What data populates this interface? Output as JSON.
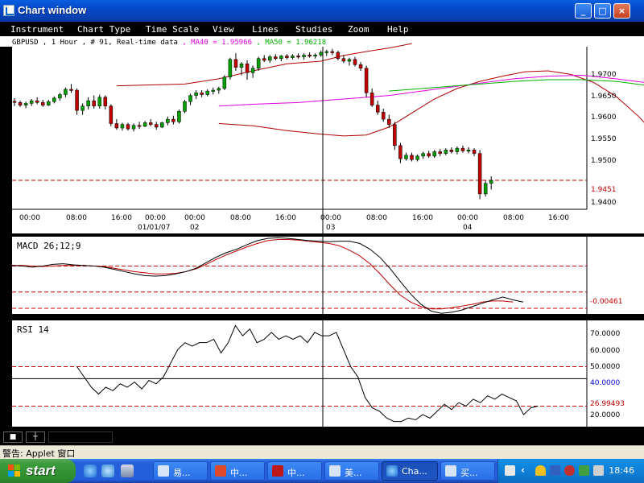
{
  "window": {
    "title": "Chart window",
    "buttons": {
      "minimize": "_",
      "maximize": "□",
      "close": "×"
    }
  },
  "menu": {
    "items": [
      "Instrument",
      "Chart Type",
      "Time Scale",
      "View",
      "Lines",
      "Studies",
      "Zoom",
      "Help"
    ]
  },
  "colors": {
    "background": "#000000",
    "panel": "#ffffff",
    "candle_up": "#00a000",
    "candle_down": "#c00000",
    "bollinger": "#b00000",
    "ma40": "#e000e0",
    "ma50": "#00b000",
    "macd": "#000000",
    "macd_signal": "#c00000",
    "rsi": "#000000",
    "dashed_level": "#c00000",
    "indicator_value": "#c00000"
  },
  "chart_header": {
    "symbol_info": "GBPUSD , 1 Hour , # 91, Real-time data",
    "ma40": ", MA40 = 1.95966",
    "ma50": ", MA50 = 1.96218"
  },
  "price_axis": {
    "ticks": [
      "1.9700",
      "1.9650",
      "1.9600",
      "1.9550",
      "1.9500",
      "1.9400"
    ],
    "current_price_label": "1.9451"
  },
  "time_axis": {
    "time_labels": [
      "00:00",
      "08:00",
      "16:00",
      "00:00",
      "00:00",
      "08:00",
      "16:00",
      "00:00",
      "08:00",
      "16:00",
      "00:00",
      "08:00",
      "16:00"
    ],
    "date_labels": [
      "01/01/07",
      "02",
      "03",
      "04"
    ]
  },
  "macd_panel": {
    "label": "MACD 26;12;9",
    "value_label": "-0.00461"
  },
  "rsi_panel": {
    "label": "RSI 14",
    "ticks": [
      "70.0000",
      "60.0000",
      "50.0000",
      "40.0000",
      "26.99493",
      "20.0000"
    ]
  },
  "chart_data": {
    "type": "line",
    "price": {
      "ylim": [
        1.9385,
        1.9755
      ],
      "ticks": [
        1.97,
        1.965,
        1.96,
        1.955,
        1.95,
        1.94
      ],
      "current_price": 1.9451,
      "candles": [
        [
          1.9631,
          1.9638,
          1.962,
          1.9628
        ],
        [
          1.9628,
          1.9632,
          1.9618,
          1.9622
        ],
        [
          1.9622,
          1.963,
          1.9615,
          1.9626
        ],
        [
          1.9626,
          1.9636,
          1.962,
          1.9632
        ],
        [
          1.9632,
          1.964,
          1.9624,
          1.9628
        ],
        [
          1.9628,
          1.9634,
          1.9618,
          1.9622
        ],
        [
          1.9622,
          1.9634,
          1.962,
          1.963
        ],
        [
          1.963,
          1.9642,
          1.9626,
          1.9638
        ],
        [
          1.9638,
          1.965,
          1.9632,
          1.9646
        ],
        [
          1.9646,
          1.9662,
          1.964,
          1.9658
        ],
        [
          1.9658,
          1.967,
          1.965,
          1.9656
        ],
        [
          1.9656,
          1.966,
          1.96,
          1.961
        ],
        [
          1.961,
          1.9626,
          1.96,
          1.962
        ],
        [
          1.962,
          1.964,
          1.9612,
          1.9632
        ],
        [
          1.9632,
          1.9644,
          1.9614,
          1.962
        ],
        [
          1.962,
          1.9646,
          1.9614,
          1.964
        ],
        [
          1.964,
          1.9644,
          1.9612,
          1.962
        ],
        [
          1.962,
          1.9624,
          1.9574,
          1.958
        ],
        [
          1.958,
          1.959,
          1.9566,
          1.957
        ],
        [
          1.957,
          1.9582,
          1.9564,
          1.9578
        ],
        [
          1.9578,
          1.9582,
          1.9564,
          1.9568
        ],
        [
          1.9568,
          1.958,
          1.9562,
          1.9576
        ],
        [
          1.9576,
          1.9584,
          1.9568,
          1.9574
        ],
        [
          1.9574,
          1.9586,
          1.9572,
          1.9582
        ],
        [
          1.9582,
          1.959,
          1.9574,
          1.9578
        ],
        [
          1.9578,
          1.9584,
          1.9566,
          1.9572
        ],
        [
          1.9572,
          1.9584,
          1.957,
          1.9582
        ],
        [
          1.9582,
          1.9596,
          1.9576,
          1.959
        ],
        [
          1.959,
          1.9598,
          1.9578,
          1.9584
        ],
        [
          1.9584,
          1.9612,
          1.958,
          1.9608
        ],
        [
          1.9608,
          1.9634,
          1.9604,
          1.963
        ],
        [
          1.963,
          1.9648,
          1.9622,
          1.9644
        ],
        [
          1.9644,
          1.9656,
          1.9636,
          1.965
        ],
        [
          1.965,
          1.9656,
          1.964,
          1.9646
        ],
        [
          1.9646,
          1.9658,
          1.9642,
          1.9654
        ],
        [
          1.9654,
          1.9662,
          1.9646,
          1.9656
        ],
        [
          1.9656,
          1.9664,
          1.9648,
          1.966
        ],
        [
          1.966,
          1.969,
          1.9656,
          1.9686
        ],
        [
          1.9686,
          1.973,
          1.968,
          1.9726
        ],
        [
          1.9726,
          1.974,
          1.97,
          1.9708
        ],
        [
          1.9708,
          1.972,
          1.969,
          1.9716
        ],
        [
          1.9716,
          1.9724,
          1.968,
          1.9696
        ],
        [
          1.9696,
          1.9712,
          1.9684,
          1.9706
        ],
        [
          1.9706,
          1.9732,
          1.97,
          1.9728
        ],
        [
          1.9728,
          1.9736,
          1.972,
          1.9724
        ],
        [
          1.9724,
          1.9736,
          1.9718,
          1.9732
        ],
        [
          1.9732,
          1.9738,
          1.9724,
          1.9728
        ],
        [
          1.9728,
          1.9736,
          1.9722,
          1.9734
        ],
        [
          1.9734,
          1.9738,
          1.9726,
          1.973
        ],
        [
          1.973,
          1.9738,
          1.9726,
          1.9734
        ],
        [
          1.9734,
          1.974,
          1.9728,
          1.9732
        ],
        [
          1.9732,
          1.974,
          1.9726,
          1.9736
        ],
        [
          1.9736,
          1.9742,
          1.973,
          1.9734
        ],
        [
          1.9734,
          1.974,
          1.9728,
          1.9736
        ],
        [
          1.9736,
          1.9746,
          1.9732,
          1.9742
        ],
        [
          1.9742,
          1.9748,
          1.9734,
          1.9744
        ],
        [
          1.9744,
          1.975,
          1.9736,
          1.9742
        ],
        [
          1.9742,
          1.9746,
          1.9724,
          1.9728
        ],
        [
          1.9728,
          1.9736,
          1.9718,
          1.9722
        ],
        [
          1.9722,
          1.973,
          1.9712,
          1.9726
        ],
        [
          1.9726,
          1.9732,
          1.971,
          1.9714
        ],
        [
          1.9714,
          1.972,
          1.97,
          1.9706
        ],
        [
          1.9706,
          1.9712,
          1.964,
          1.965
        ],
        [
          1.965,
          1.966,
          1.9618,
          1.9622
        ],
        [
          1.9622,
          1.9632,
          1.96,
          1.9606
        ],
        [
          1.9606,
          1.9614,
          1.9584,
          1.959
        ],
        [
          1.959,
          1.96,
          1.957,
          1.9578
        ],
        [
          1.9578,
          1.9584,
          1.952,
          1.953
        ],
        [
          1.953,
          1.9536,
          1.949,
          1.95
        ],
        [
          1.95,
          1.9514,
          1.9496,
          1.9508
        ],
        [
          1.9508,
          1.9514,
          1.9494,
          1.9498
        ],
        [
          1.9498,
          1.951,
          1.9494,
          1.9506
        ],
        [
          1.9506,
          1.9516,
          1.95,
          1.9512
        ],
        [
          1.9512,
          1.9518,
          1.9502,
          1.9506
        ],
        [
          1.9506,
          1.952,
          1.9502,
          1.9516
        ],
        [
          1.9516,
          1.9522,
          1.9506,
          1.9512
        ],
        [
          1.9512,
          1.9524,
          1.9508,
          1.952
        ],
        [
          1.952,
          1.9526,
          1.9512,
          1.9516
        ],
        [
          1.9516,
          1.9528,
          1.951,
          1.9524
        ],
        [
          1.9524,
          1.953,
          1.9514,
          1.9518
        ],
        [
          1.9518,
          1.9526,
          1.9512,
          1.952
        ],
        [
          1.952,
          1.9524,
          1.9506,
          1.9512
        ],
        [
          1.9512,
          1.952,
          1.9408,
          1.942
        ],
        [
          1.942,
          1.945,
          1.9414,
          1.9444
        ],
        [
          1.9444,
          1.946,
          1.943,
          1.9451
        ]
      ],
      "bollinger_upper": [
        [
          1.9666,
          9
        ],
        [
          1.9668,
          12
        ],
        [
          1.967,
          15
        ],
        [
          1.9682,
          18
        ],
        [
          1.97,
          21
        ],
        [
          1.9716,
          24
        ],
        [
          1.9722,
          27
        ],
        [
          1.9735,
          29
        ],
        [
          1.9744,
          31
        ],
        [
          1.9752,
          33
        ],
        [
          1.9762,
          35
        ]
      ],
      "bollinger_lower": [
        [
          1.958,
          18
        ],
        [
          1.9575,
          21
        ],
        [
          1.9564,
          24
        ],
        [
          1.9556,
          27
        ],
        [
          1.9552,
          29
        ],
        [
          1.9554,
          31
        ],
        [
          1.9572,
          33
        ],
        [
          1.9604,
          35
        ],
        [
          1.9636,
          37
        ],
        [
          1.966,
          39
        ],
        [
          1.9676,
          41
        ],
        [
          1.9688,
          43
        ],
        [
          1.9698,
          45
        ],
        [
          1.97,
          47
        ],
        [
          1.9692,
          49
        ],
        [
          1.9674,
          51
        ],
        [
          1.9642,
          53
        ],
        [
          1.9596,
          55
        ],
        [
          1.954,
          57
        ],
        [
          1.9494,
          59
        ],
        [
          1.946,
          61
        ],
        [
          1.944,
          63
        ],
        [
          1.9426,
          65
        ],
        [
          1.9422,
          67
        ],
        [
          1.9436,
          69
        ],
        [
          1.9466,
          71
        ]
      ],
      "ma40": [
        [
          1.962,
          18
        ],
        [
          1.9624,
          21
        ],
        [
          1.9628,
          25
        ],
        [
          1.9636,
          29
        ],
        [
          1.9644,
          33
        ],
        [
          1.9658,
          37
        ],
        [
          1.9672,
          41
        ],
        [
          1.9682,
          44
        ],
        [
          1.9688,
          47
        ],
        [
          1.969,
          50
        ],
        [
          1.9682,
          53
        ],
        [
          1.9672,
          56
        ],
        [
          1.9658,
          59
        ],
        [
          1.9644,
          62
        ],
        [
          1.963,
          65
        ],
        [
          1.961,
          68
        ],
        [
          1.9597,
          71
        ]
      ],
      "ma50": [
        [
          1.9654,
          33
        ],
        [
          1.9662,
          37
        ],
        [
          1.967,
          41
        ],
        [
          1.9676,
          44
        ],
        [
          1.968,
          47
        ],
        [
          1.968,
          50
        ],
        [
          1.9676,
          53
        ],
        [
          1.9666,
          56
        ],
        [
          1.9654,
          59
        ],
        [
          1.9644,
          62
        ],
        [
          1.9636,
          65
        ],
        [
          1.9628,
          68
        ],
        [
          1.9622,
          71
        ]
      ]
    },
    "macd": {
      "ylim": [
        -0.0085,
        0.0052
      ],
      "macd_line": [
        0.0001,
        0.0,
        -0.0002,
        0.0,
        0.0003,
        0.0004,
        0.0002,
        0.0001,
        0.0,
        -0.0002,
        -0.0006,
        -0.001,
        -0.0014,
        -0.0017,
        -0.0018,
        -0.0017,
        -0.0014,
        -0.001,
        -0.0004,
        0.0006,
        0.0016,
        0.0024,
        0.003,
        0.0038,
        0.0045,
        0.0049,
        0.005,
        0.0049,
        0.0047,
        0.0045,
        0.0044,
        0.0043,
        0.0044,
        0.0044,
        0.004,
        0.003,
        0.0015,
        -0.0005,
        -0.0028,
        -0.005,
        -0.0068,
        -0.008,
        -0.0084,
        -0.0082,
        -0.0078,
        -0.0072,
        -0.0066,
        -0.006,
        -0.0055,
        -0.006,
        -0.0064
      ],
      "signal_line": [
        0.0001,
        0.0001,
        0.0,
        -0.0001,
        0.0,
        0.0001,
        0.0001,
        0.0001,
        0.0,
        -0.0001,
        -0.0004,
        -0.0007,
        -0.001,
        -0.0012,
        -0.0014,
        -0.0014,
        -0.0013,
        -0.001,
        -0.0005,
        0.0003,
        0.0012,
        0.002,
        0.0027,
        0.0034,
        0.004,
        0.0045,
        0.0047,
        0.0047,
        0.0046,
        0.0044,
        0.0042,
        0.004,
        0.0036,
        0.0028,
        0.0018,
        0.0004,
        -0.0014,
        -0.0034,
        -0.0052,
        -0.0064,
        -0.0072,
        -0.0076,
        -0.0076,
        -0.0074,
        -0.0071,
        -0.0068,
        -0.0064,
        -0.0062,
        -0.0062,
        -0.0064
      ],
      "levels": [
        0.0,
        -0.0075,
        -0.00461
      ],
      "current": -0.00461
    },
    "rsi": {
      "ylim": [
        15,
        77
      ],
      "ticks": [
        70,
        60,
        50,
        40,
        26.99493,
        20
      ],
      "levels": [
        50,
        26.99493
      ],
      "reference_line": 43,
      "current": 26.99493,
      "values": [
        [
          50,
          9
        ],
        [
          44,
          10
        ],
        [
          38,
          11
        ],
        [
          34,
          12
        ],
        [
          38,
          13
        ],
        [
          36,
          14
        ],
        [
          40,
          15
        ],
        [
          38,
          16
        ],
        [
          41,
          17
        ],
        [
          37,
          18
        ],
        [
          42,
          19
        ],
        [
          40,
          20
        ],
        [
          44,
          21
        ],
        [
          52,
          22
        ],
        [
          60,
          23
        ],
        [
          64,
          24
        ],
        [
          62,
          25
        ],
        [
          64,
          26
        ],
        [
          64,
          27
        ],
        [
          66,
          28
        ],
        [
          58,
          29
        ],
        [
          64,
          30
        ],
        [
          74,
          31
        ],
        [
          68,
          32
        ],
        [
          72,
          33
        ],
        [
          64,
          34
        ],
        [
          66,
          35
        ],
        [
          70,
          36
        ],
        [
          66,
          37
        ],
        [
          68,
          38
        ],
        [
          66,
          39
        ],
        [
          68,
          40
        ],
        [
          64,
          41
        ],
        [
          70,
          42
        ],
        [
          68,
          43
        ],
        [
          68,
          44
        ],
        [
          70,
          45
        ],
        [
          60,
          46
        ],
        [
          50,
          47
        ],
        [
          44,
          48
        ],
        [
          32,
          49
        ],
        [
          26,
          50
        ],
        [
          24,
          51
        ],
        [
          20,
          52
        ],
        [
          18,
          53
        ],
        [
          18,
          54
        ],
        [
          20,
          55
        ],
        [
          19,
          56
        ],
        [
          22,
          57
        ],
        [
          20,
          58
        ],
        [
          24,
          59
        ],
        [
          28,
          60
        ],
        [
          25,
          61
        ],
        [
          29,
          62
        ],
        [
          27,
          63
        ],
        [
          31,
          64
        ],
        [
          29,
          65
        ],
        [
          33,
          66
        ],
        [
          31,
          67
        ],
        [
          34,
          68
        ],
        [
          32,
          69
        ],
        [
          30,
          70
        ],
        [
          22,
          71
        ],
        [
          26,
          72
        ],
        [
          27,
          73
        ]
      ]
    }
  },
  "bottom_toolbar": {
    "btn1": "■",
    "btn2": "┼"
  },
  "status_bar": {
    "text": "警告: Applet 窗口"
  },
  "taskbar": {
    "start": "start",
    "tasks": [
      "易...",
      "中...",
      "中...",
      "美...",
      "Cha...",
      "买..."
    ],
    "clock": "18:46"
  }
}
